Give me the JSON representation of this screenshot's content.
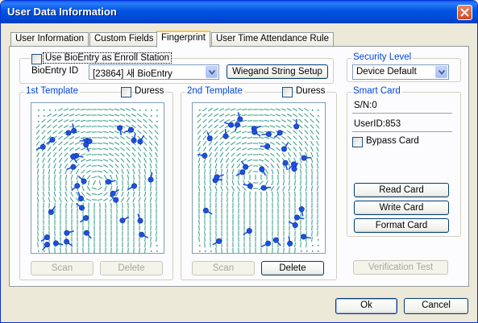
{
  "window": {
    "title": "User Data Information"
  },
  "tabs": [
    "User Information",
    "Custom Fields",
    "Fingerprint",
    "User Time Attendance Rule"
  ],
  "enroll": {
    "use_bioentry_label": "Use BioEntry as Enroll Station",
    "bioentry_id_label": "BioEntry ID",
    "bioentry_value": "[23864] 새 BioEntry",
    "wiegand_button": "Wiegand String Setup"
  },
  "security": {
    "group_label": "Security Level",
    "value": "Device Default"
  },
  "template1": {
    "group_label": "1st Template",
    "duress_label": "Duress",
    "scan_button": "Scan",
    "delete_button": "Delete"
  },
  "template2": {
    "group_label": "2nd Template",
    "duress_label": "Duress",
    "scan_button": "Scan",
    "delete_button": "Delete"
  },
  "smart_card": {
    "group_label": "Smart Card",
    "serial": "S/N:0",
    "user_id": "UserID:853",
    "bypass_label": "Bypass Card",
    "read_button": "Read Card",
    "write_button": "Write Card",
    "format_button": "Format Card"
  },
  "verification_button": "Verification Test",
  "footer": {
    "ok_button": "Ok",
    "cancel_button": "Cancel"
  },
  "colors": {
    "title_bar": "#0054e3",
    "group_label": "#0046d5",
    "ridge": "#2e9a86",
    "minutia": "#1e50e0"
  },
  "icons": [
    "close-icon",
    "chevron-down-icon",
    "fingerprint-icon"
  ]
}
